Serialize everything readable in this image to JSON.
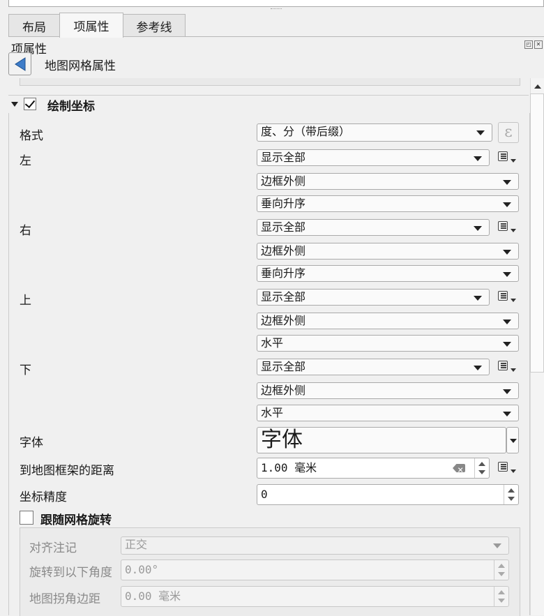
{
  "tabs": [
    {
      "label": "布局"
    },
    {
      "label": "项属性",
      "active": true
    },
    {
      "label": "参考线"
    }
  ],
  "panel": {
    "title": "项属性",
    "subtitle": "地图网格属性"
  },
  "section": {
    "title": "绘制坐标",
    "checked": true
  },
  "format": {
    "label": "格式",
    "value": "度、分（带后缀）",
    "expr_icon": "ε"
  },
  "sides": [
    {
      "label": "左",
      "display": "显示全部",
      "position": "边框外侧",
      "direction": "垂向升序"
    },
    {
      "label": "右",
      "display": "显示全部",
      "position": "边框外侧",
      "direction": "垂向升序"
    },
    {
      "label": "上",
      "display": "显示全部",
      "position": "边框外侧",
      "direction": "水平"
    },
    {
      "label": "下",
      "display": "显示全部",
      "position": "边框外侧",
      "direction": "水平"
    }
  ],
  "font": {
    "label": "字体",
    "button": "字体"
  },
  "distance": {
    "label": "到地图框架的距离",
    "value": "1.00",
    "unit": "毫米"
  },
  "precision": {
    "label": "坐标精度",
    "value": "0"
  },
  "follow_rotation": {
    "label": "跟随网格旋转",
    "checked": false
  },
  "rotation_group": {
    "align_label": "对齐注记",
    "align_value": "正交",
    "rotate_label": "旋转到以下角度",
    "rotate_value": "0.00°",
    "corner_label": "地图拐角边距",
    "corner_value": "0.00",
    "corner_unit": "毫米"
  },
  "icons": {
    "back": "back-arrow-icon",
    "data_defined": "data-defined-override-icon",
    "expression": "expression-icon",
    "clear": "clear-icon"
  }
}
